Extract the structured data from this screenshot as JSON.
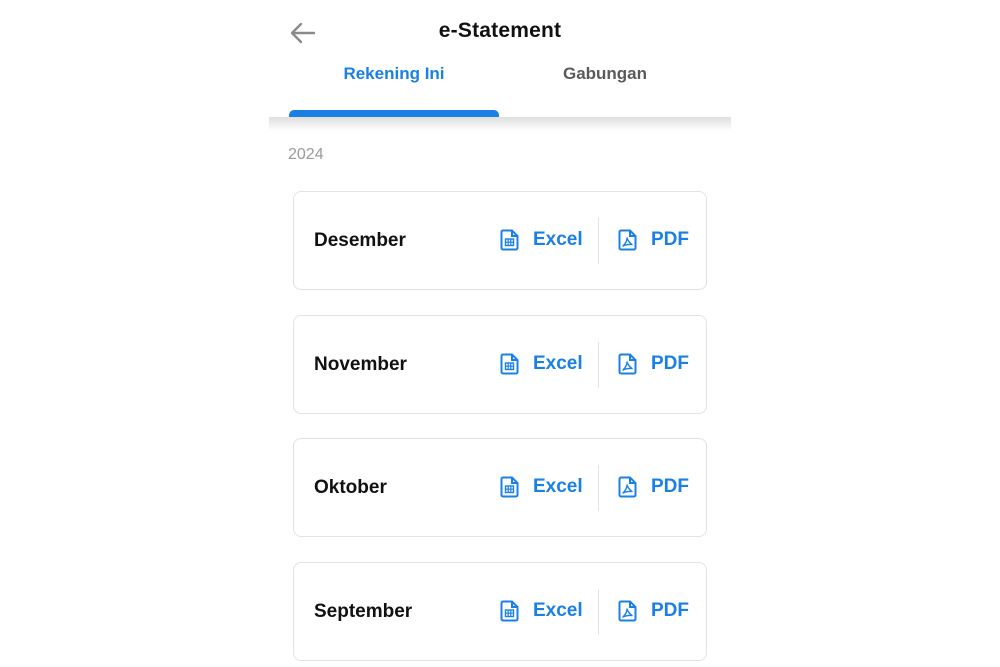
{
  "header": {
    "title": "e-Statement",
    "back_icon": "arrow-left-icon"
  },
  "tabs": [
    {
      "label": "Rekening Ini",
      "active": true
    },
    {
      "label": "Gabungan",
      "active": false
    }
  ],
  "colors": {
    "accent": "#1a80e6",
    "inactive_tab": "#5a5a5a",
    "year_text": "#9a9a9a",
    "card_border": "#e3e3e3"
  },
  "year": "2024",
  "statements": [
    {
      "month": "Desember",
      "excel_label": "Excel",
      "pdf_label": "PDF"
    },
    {
      "month": "November",
      "excel_label": "Excel",
      "pdf_label": "PDF"
    },
    {
      "month": "Oktober",
      "excel_label": "Excel",
      "pdf_label": "PDF"
    },
    {
      "month": "September",
      "excel_label": "Excel",
      "pdf_label": "PDF"
    }
  ],
  "icons": {
    "excel": "spreadsheet-file-icon",
    "pdf": "pdf-file-icon"
  }
}
